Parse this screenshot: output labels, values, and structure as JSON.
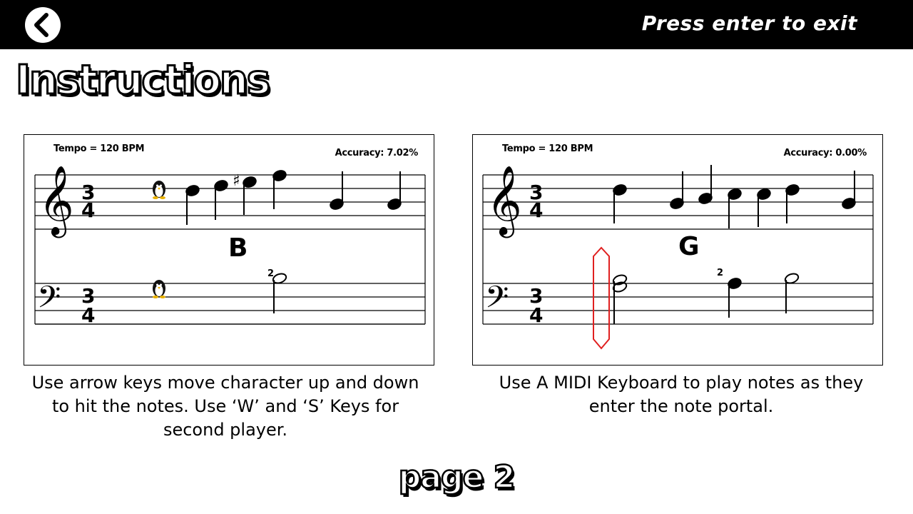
{
  "header": {
    "back_icon": "chevron-left-icon",
    "exit_hint": "Press enter to exit"
  },
  "title": "Instructions",
  "panels": [
    {
      "tempo": "Tempo = 120 BPM",
      "accuracy": "Accuracy: 7.02%",
      "note_name": "B",
      "time_signature": "3/4",
      "chord_label": "2",
      "character": "penguin",
      "caption": "Use arrow keys move character up and down to hit the notes. Use ‘W’ and ‘S’ Keys for second player."
    },
    {
      "tempo": "Tempo = 120 BPM",
      "accuracy": "Accuracy: 0.00%",
      "note_name": "G",
      "time_signature": "3/4",
      "chord_label": "2",
      "portal_color": "#e02020",
      "caption": "Use A MIDI Keyboard to play notes as they enter the note portal."
    }
  ],
  "page_label": "page 2"
}
